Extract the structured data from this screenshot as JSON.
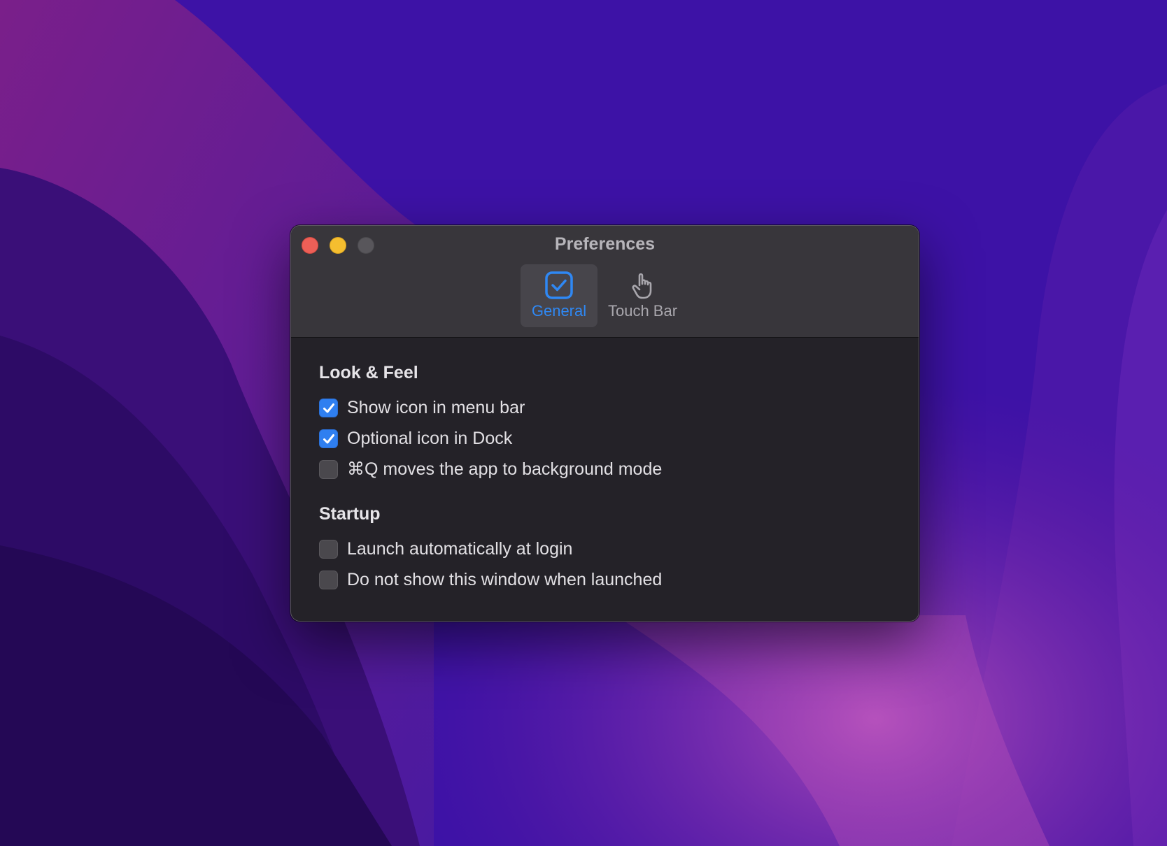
{
  "window": {
    "title": "Preferences"
  },
  "toolbar": {
    "tabs": [
      {
        "label": "General",
        "icon": "checkmark-square-icon",
        "selected": true
      },
      {
        "label": "Touch Bar",
        "icon": "hand-pointer-icon",
        "selected": false
      }
    ]
  },
  "sections": [
    {
      "title": "Look & Feel",
      "options": [
        {
          "label": "Show icon in menu bar",
          "checked": true
        },
        {
          "label": "Optional icon in Dock",
          "checked": true
        },
        {
          "label": "⌘Q moves the app to background mode",
          "checked": false
        }
      ]
    },
    {
      "title": "Startup",
      "options": [
        {
          "label": "Launch automatically at login",
          "checked": false
        },
        {
          "label": "Do not show this window when launched",
          "checked": false
        }
      ]
    }
  ],
  "colors": {
    "accent": "#2f7ff0",
    "close": "#ed5f57",
    "minimize": "#f5be2f",
    "zoom_inactive": "#58565b"
  }
}
